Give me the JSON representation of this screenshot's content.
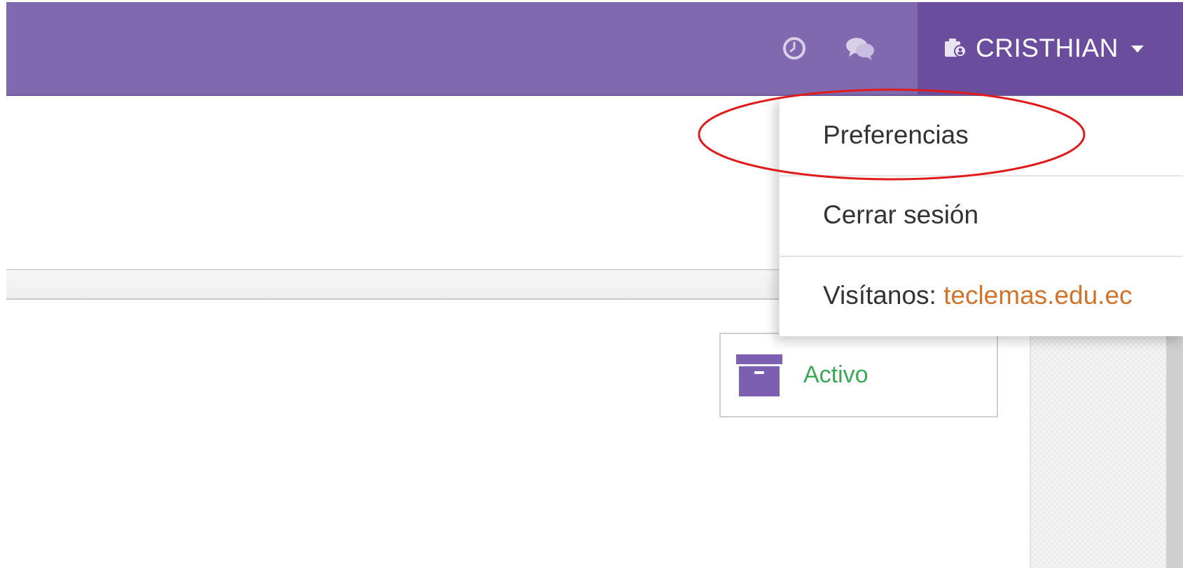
{
  "navbar": {
    "background_color": "#8069ae",
    "history_icon": "clock-icon",
    "messages_icon": "chat-bubbles-icon"
  },
  "user_menu": {
    "icon": "user-badge-icon",
    "name": "CRISTHIAN",
    "background_color": "#6a4d9c"
  },
  "dropdown": {
    "preferences_label": "Preferencias",
    "logout_label": "Cerrar sesión",
    "visit_label": "Visítanos:",
    "visit_link": "teclemas.edu.ec",
    "link_color": "#d2732a"
  },
  "status": {
    "icon": "archive-box-icon",
    "label": "Activo",
    "color": "#3aa957"
  },
  "annotation": {
    "color": "#e01b1b"
  }
}
